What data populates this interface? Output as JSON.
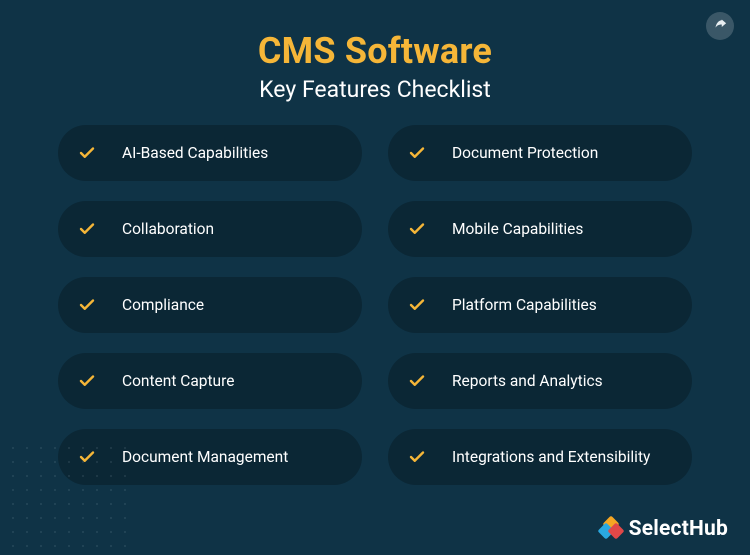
{
  "colors": {
    "background": "#0f3346",
    "pill": "#0b2735",
    "accent": "#f5b638",
    "text": "#ffffff"
  },
  "header": {
    "title": "CMS Software",
    "subtitle": "Key Features Checklist"
  },
  "features_left": [
    {
      "label": "AI-Based Capabilities"
    },
    {
      "label": "Collaboration"
    },
    {
      "label": "Compliance"
    },
    {
      "label": "Content Capture"
    },
    {
      "label": "Document Management"
    }
  ],
  "features_right": [
    {
      "label": "Document Protection"
    },
    {
      "label": "Mobile Capabilities"
    },
    {
      "label": "Platform Capabilities"
    },
    {
      "label": "Reports and Analytics"
    },
    {
      "label": "Integrations and Extensibility"
    }
  ],
  "footer": {
    "brand": "SelectHub"
  },
  "icons": {
    "share": "share-arrow-icon",
    "check": "check-icon"
  }
}
